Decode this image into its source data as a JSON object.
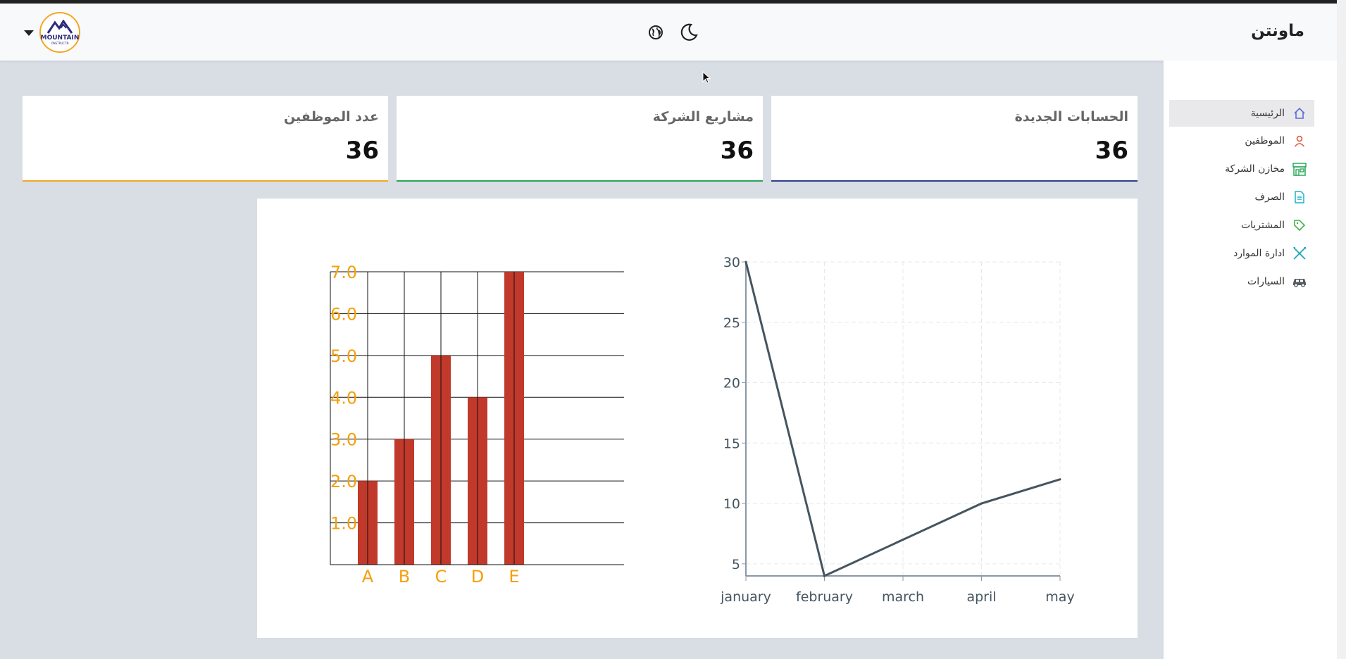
{
  "header": {
    "brand": "ماونتن",
    "logo_text": "MOUNTAIN",
    "logo_sub": "ONSTRUCTN"
  },
  "sidebar": {
    "items": [
      {
        "label": "الرئيسية",
        "icon": "home-icon",
        "color": "#5b6bd5",
        "active": true
      },
      {
        "label": "الموظفين",
        "icon": "user-icon",
        "color": "#e0563a"
      },
      {
        "label": "مخازن الشركة",
        "icon": "store-icon",
        "color": "#2eaa5b"
      },
      {
        "label": "الصرف",
        "icon": "document-icon",
        "color": "#1ab2c9"
      },
      {
        "label": "المشتريات",
        "icon": "tag-icon",
        "color": "#44b14a"
      },
      {
        "label": "ادارة الموارد",
        "icon": "tools-icon",
        "color": "#16a6b8"
      },
      {
        "label": "السيارات",
        "icon": "car-icon",
        "color": "#555a63"
      }
    ]
  },
  "cards": [
    {
      "title": "الحسابات الجديدة",
      "value": "36",
      "accent": "#2d3f8f"
    },
    {
      "title": "مشاريع الشركة",
      "value": "36",
      "accent": "#27a55a"
    },
    {
      "title": "عدد الموظفين",
      "value": "36",
      "accent": "#f0a824"
    }
  ],
  "chart_data": [
    {
      "type": "bar",
      "categories": [
        "A",
        "B",
        "C",
        "D",
        "E"
      ],
      "values": [
        2,
        3,
        5,
        4,
        7
      ],
      "ylim": [
        0,
        7
      ],
      "yticks": [
        "1.0",
        "2.0",
        "3.0",
        "4.0",
        "5.0",
        "6.0",
        "7.0"
      ],
      "bar_color": "#c0392b",
      "label_color": "#f5a00a",
      "grid": true
    },
    {
      "type": "line",
      "categories": [
        "january",
        "february",
        "march",
        "april",
        "may"
      ],
      "values": [
        30,
        4,
        7,
        10,
        12
      ],
      "ylim": [
        4,
        30
      ],
      "yticks": [
        "5",
        "10",
        "15",
        "20",
        "25",
        "30"
      ],
      "line_color": "#455560",
      "grid": true
    }
  ]
}
